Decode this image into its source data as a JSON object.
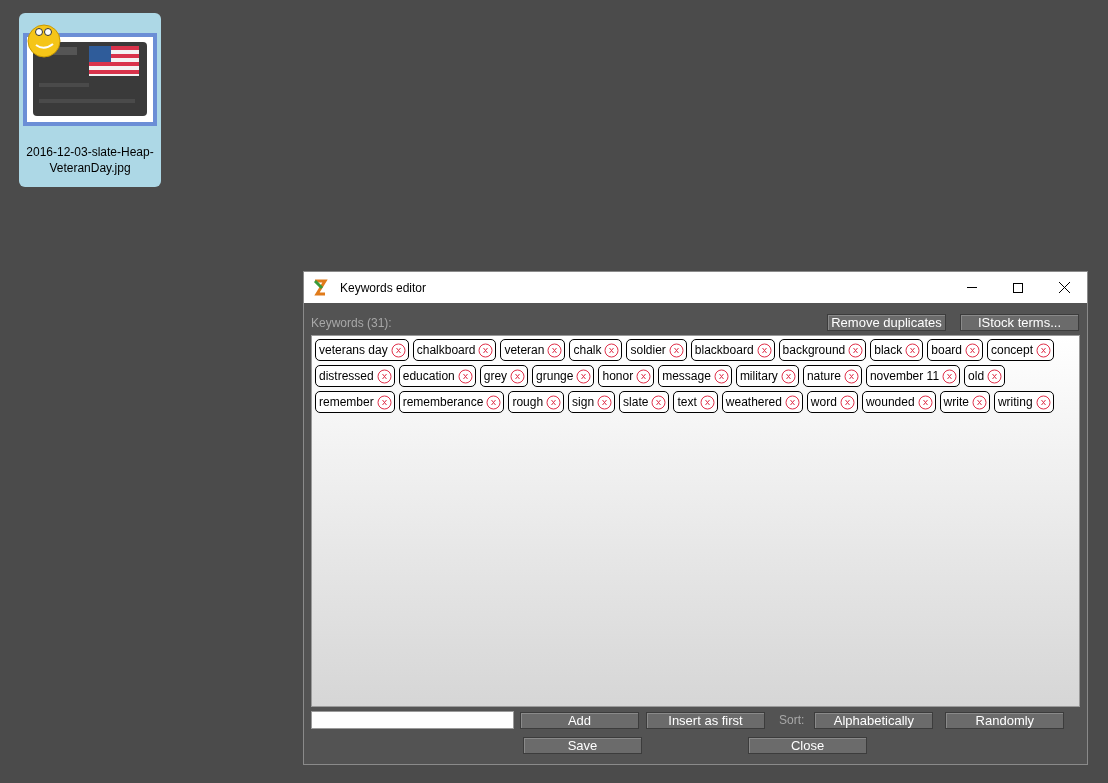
{
  "desktop_item": {
    "filename": "2016-12-03-slate-Heap-VeteranDay.jpg"
  },
  "window": {
    "title": "Keywords editor"
  },
  "keywords_label": "Keywords (31):",
  "top_buttons": [
    "Remove duplicates",
    "IStock terms..."
  ],
  "keywords": [
    "veterans day",
    "chalkboard",
    "veteran",
    "chalk",
    "soldier",
    "blackboard",
    "background",
    "black",
    "board",
    "concept",
    "distressed",
    "education",
    "grey",
    "grunge",
    "honor",
    "message",
    "military",
    "nature",
    "november 11",
    "old",
    "remember",
    "rememberance",
    "rough",
    "sign",
    "slate",
    "text",
    "weathered",
    "word",
    "wounded",
    "write",
    "writing"
  ],
  "add_buttons": [
    "Add",
    "Insert as first"
  ],
  "sort_label": "Sort:",
  "sort_buttons": [
    "Alphabetically",
    "Randomly"
  ],
  "bottom_buttons": [
    "Save",
    "Close"
  ]
}
